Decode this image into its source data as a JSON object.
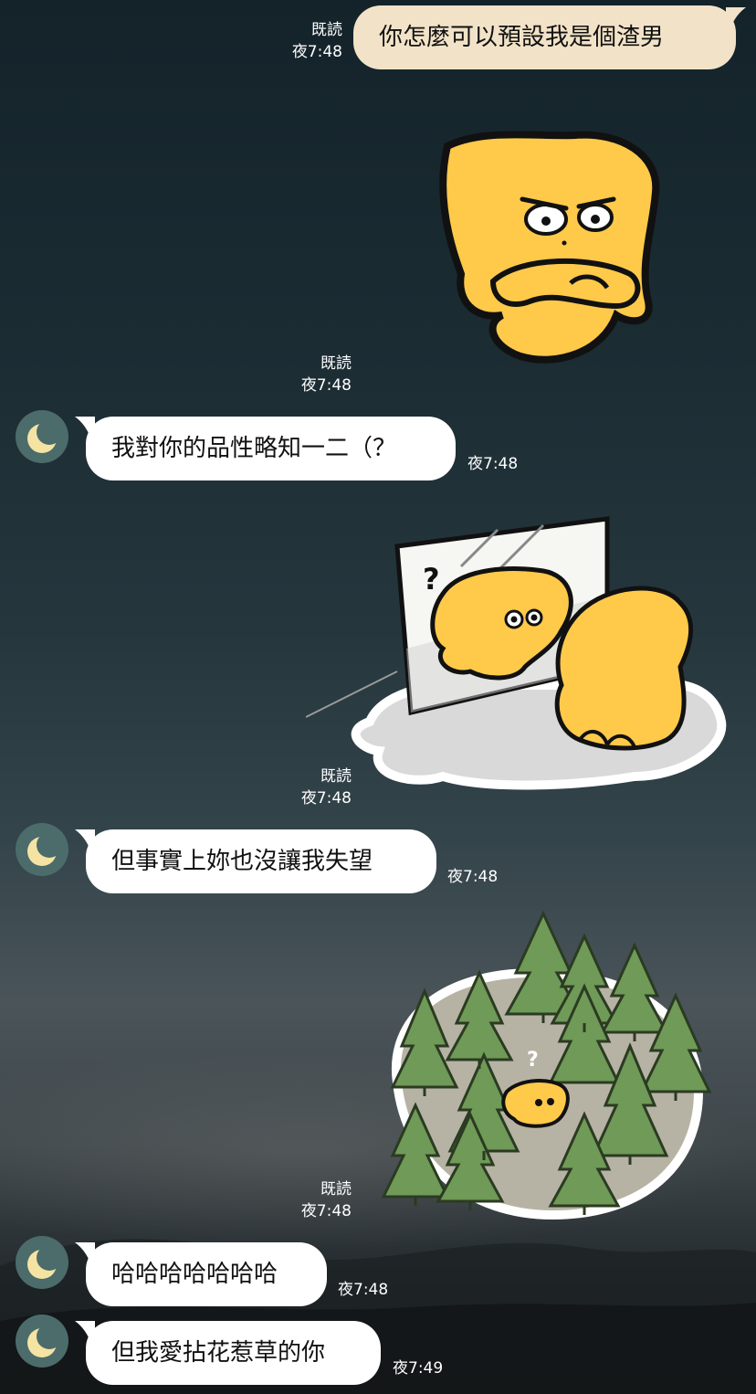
{
  "messages": [
    {
      "id": "m1",
      "type": "text",
      "side": "out",
      "text": "你怎麼可以預設我是個渣男",
      "read": "既読",
      "time": "夜7:48"
    },
    {
      "id": "m2",
      "type": "sticker",
      "side": "out",
      "sticker": "yellow-blob-arms-crossed-sticker",
      "read": "既読",
      "time": "夜7:48"
    },
    {
      "id": "m3",
      "type": "text",
      "side": "in",
      "text": "我對你的品性略知一二（？",
      "time": "夜7:48"
    },
    {
      "id": "m4",
      "type": "sticker",
      "side": "out",
      "sticker": "yellow-blob-window-question-sticker",
      "read": "既読",
      "time": "夜7:48"
    },
    {
      "id": "m5",
      "type": "text",
      "side": "in",
      "text": "但事實上妳也沒讓我失望",
      "time": "夜7:48"
    },
    {
      "id": "m6",
      "type": "sticker",
      "side": "out",
      "sticker": "yellow-blob-in-forest-sticker",
      "read": "既読",
      "time": "夜7:48"
    },
    {
      "id": "m7",
      "type": "text",
      "side": "in",
      "text": "哈哈哈哈哈哈哈",
      "time": "夜7:48"
    },
    {
      "id": "m8",
      "type": "text",
      "side": "in",
      "text": "但我愛拈花惹草的你",
      "time": "夜7:49"
    }
  ],
  "colors": {
    "outgoing_bubble": "#f2e3c8",
    "incoming_bubble": "#ffffff",
    "avatar_bg": "#4b6c6a",
    "moon": "#f5e3a3",
    "blob": "#ffc94a",
    "tree": "#6f9a57"
  },
  "contact": {
    "avatar_icon": "crescent-moon-icon"
  }
}
